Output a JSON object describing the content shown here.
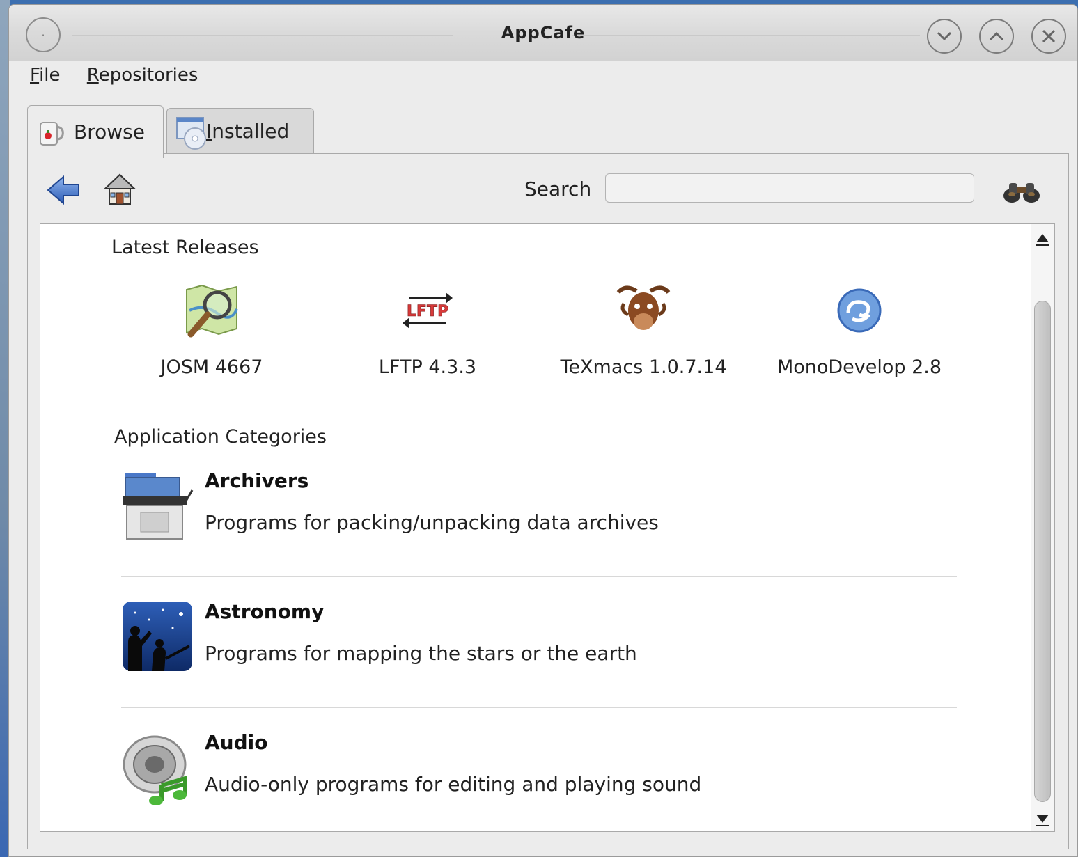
{
  "window": {
    "title": "AppCafe"
  },
  "menubar": {
    "items": [
      {
        "label_first": "F",
        "label_rest": "ile"
      },
      {
        "label_first": "R",
        "label_rest": "epositories"
      }
    ]
  },
  "tabs": [
    {
      "label": "Browse",
      "icon": "coffee-mug-icon",
      "selected": true
    },
    {
      "label_first": "I",
      "label_rest": "nstalled",
      "icon": "installed-disc-icon",
      "selected": false
    }
  ],
  "toolbar": {
    "back_icon": "back-arrow-icon",
    "home_icon": "home-icon",
    "search_label": "Search",
    "search_value": "",
    "search_icon": "binoculars-icon"
  },
  "latest": {
    "title": "Latest Releases",
    "items": [
      {
        "name": "JOSM 4667",
        "icon": "josm-map-magnifier-icon"
      },
      {
        "name": "LFTP 4.3.3",
        "icon": "lftp-arrows-icon"
      },
      {
        "name": "TeXmacs 1.0.7.14",
        "icon": "gnu-head-icon"
      },
      {
        "name": "MonoDevelop 2.8",
        "icon": "monodevelop-swirl-icon"
      }
    ]
  },
  "categories": {
    "title": "Application Categories",
    "items": [
      {
        "name": "Archivers",
        "description": "Programs for packing/unpacking data archives",
        "icon": "archive-box-icon"
      },
      {
        "name": "Astronomy",
        "description": "Programs for mapping the stars or the earth",
        "icon": "stargazers-icon"
      },
      {
        "name": "Audio",
        "description": "Audio-only programs for editing and playing sound",
        "icon": "speaker-music-note-icon"
      }
    ]
  },
  "colors": {
    "window_bg": "#ececec",
    "content_bg": "#ffffff",
    "accent_blue": "#4a78c8"
  }
}
